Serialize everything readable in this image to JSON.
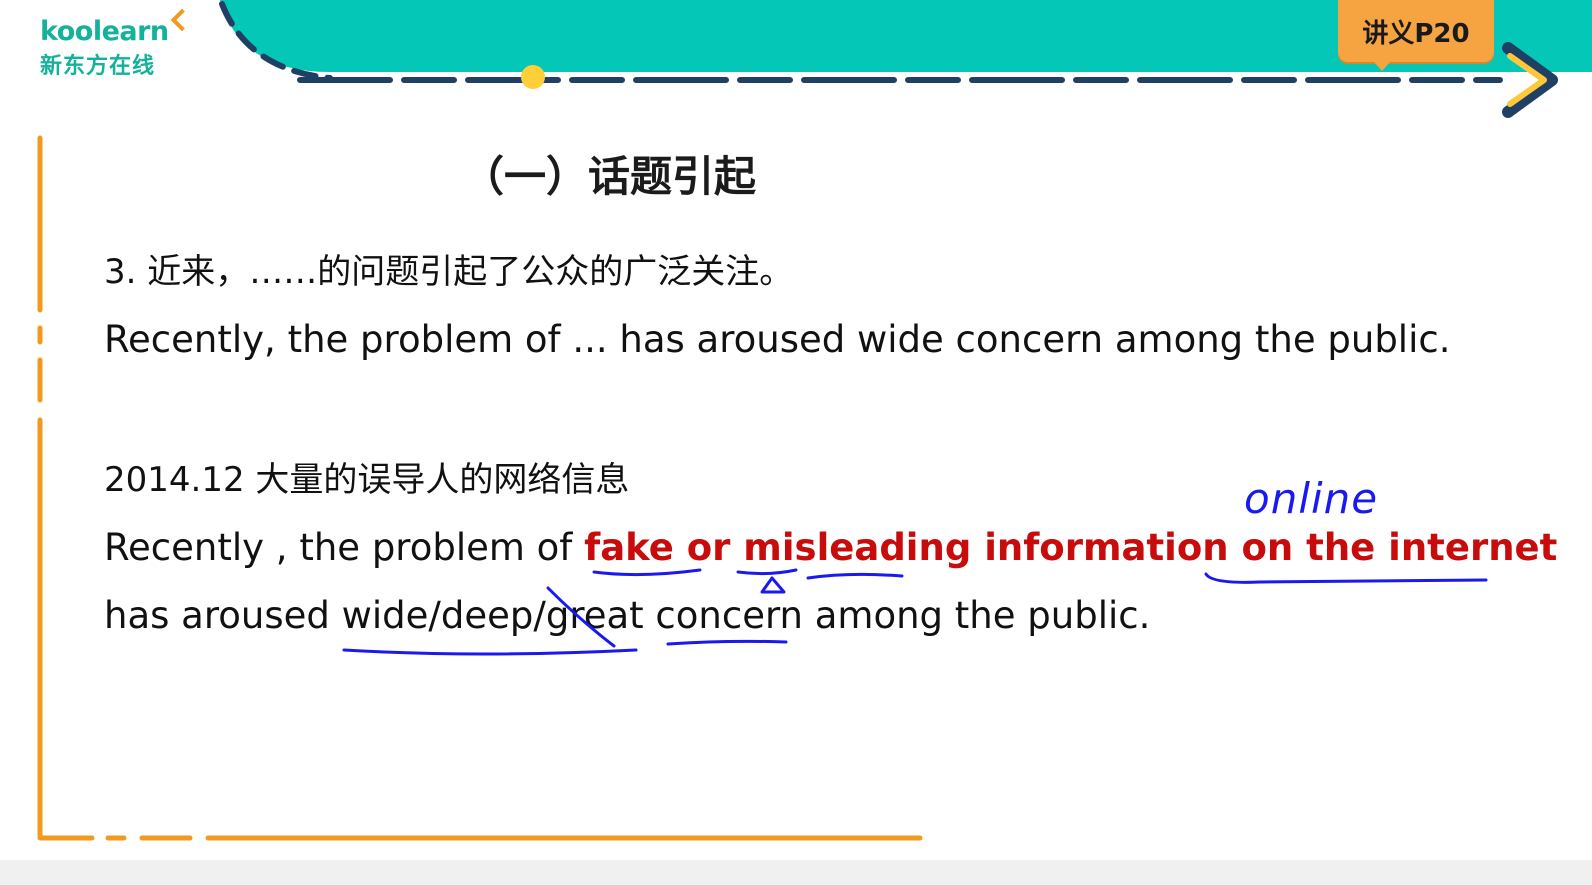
{
  "brand": {
    "logo_word": "koolearn",
    "logo_sub": "新东方在线"
  },
  "badge": {
    "label": "讲义P20"
  },
  "slide": {
    "heading": "（一）话题引起",
    "item_cn": "3. 近来，……的问题引起了公众的广泛关注。",
    "item_en": "Recently, the problem of ... has aroused wide concern among the public.",
    "example_cn": "2014.12 大量的误导人的网络信息",
    "example_en_prefix": "Recently , the problem of ",
    "example_en_highlight": "fake or misleading information on the internet",
    "example_en_line2": "has aroused wide/deep/great concern among the public."
  },
  "annotations": {
    "handwritten_word": "online"
  },
  "colors": {
    "teal": "#04c7b7",
    "navy": "#1f3f63",
    "orange": "#f29a1f",
    "red_text": "#c80b0b",
    "ink_blue": "#1a1af0"
  }
}
